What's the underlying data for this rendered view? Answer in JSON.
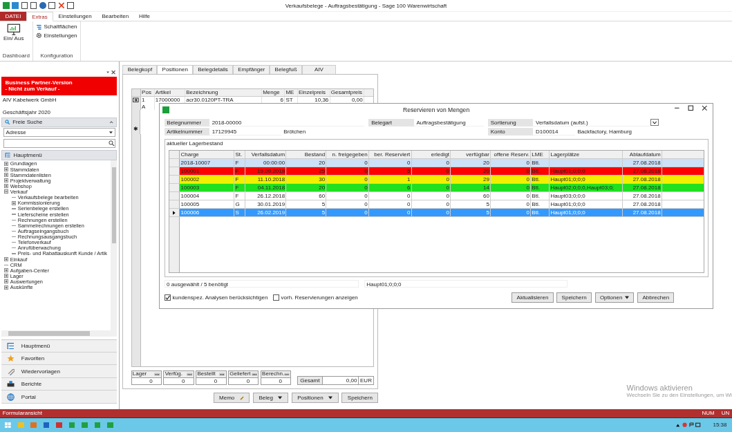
{
  "window": {
    "title": "Verkaufsbelege - Auftragsbestätigung - Sage 100 Warenwirtschaft"
  },
  "ribbon": {
    "tabs": [
      {
        "label": "DATEI",
        "kind": "file",
        "selected": false
      },
      {
        "label": "Extras",
        "kind": "tab",
        "selected": true
      },
      {
        "label": "Einstellungen",
        "kind": "tab",
        "selected": false
      },
      {
        "label": "Bearbeiten",
        "kind": "tab",
        "selected": false
      },
      {
        "label": "Hilfe",
        "kind": "tab",
        "selected": false
      }
    ],
    "groups": [
      {
        "label": "Dashboard",
        "buttons": [
          {
            "label": "Ein/ Aus",
            "kind": "large"
          }
        ]
      },
      {
        "label": "Konfiguration",
        "buttons": [
          {
            "label": "Schaltflächen",
            "kind": "list"
          },
          {
            "label": "Einstellungen",
            "kind": "gear"
          }
        ]
      }
    ]
  },
  "sidebar": {
    "banner": [
      "Business Partner-Version",
      "- Nicht zum Verkauf -"
    ],
    "company": "AIV Kabelwerk GmbH",
    "fiscal_year": "Geschäftsjahr 2020",
    "search": {
      "title": "Freie Suche",
      "category": "Adresse"
    },
    "menu_title": "Hauptmenü",
    "tree": [
      {
        "label": "Grundlagen",
        "expanded": false
      },
      {
        "label": "Stammdaten",
        "expanded": false
      },
      {
        "label": "Stammdatenlisten",
        "expanded": false
      },
      {
        "label": "Projektverwaltung",
        "expanded": false
      },
      {
        "label": "Webshop",
        "expanded": false
      },
      {
        "label": "Verkauf",
        "expanded": true,
        "children": [
          {
            "label": "Verkaufsbelege bearbeiten"
          },
          {
            "label": "Kommissionierung",
            "expanded": false
          },
          {
            "label": "Serienbelege erstellen"
          },
          {
            "label": "Lieferscheine erstellen"
          },
          {
            "label": "Rechnungen erstellen"
          },
          {
            "label": "Sammelrechnungen erstellen"
          },
          {
            "label": "Auftragseingangsbuch"
          },
          {
            "label": "Rechnungsausgangsbuch"
          },
          {
            "label": "Telefonverkauf"
          },
          {
            "label": "Anrufüberwachung"
          },
          {
            "label": "Preis- und Rabattauskunft Kunde / Artik"
          }
        ]
      },
      {
        "label": "Einkauf",
        "expanded": false
      },
      {
        "label": "CRM"
      },
      {
        "label": "Aufgaben-Center",
        "expanded": false
      },
      {
        "label": "Lager",
        "expanded": false
      },
      {
        "label": "Auswertungen",
        "expanded": false
      },
      {
        "label": "Auskünfte",
        "expanded": false
      }
    ],
    "nav": [
      {
        "label": "Hauptmenü",
        "kind": "menu"
      },
      {
        "label": "Favoriten",
        "kind": "star"
      },
      {
        "label": "Wiedervorlagen",
        "kind": "clip"
      },
      {
        "label": "Berichte",
        "kind": "printer"
      },
      {
        "label": "Portal",
        "kind": "globe"
      }
    ]
  },
  "document_tabs": [
    {
      "label": "Belegkopf",
      "selected": false
    },
    {
      "label": "Positionen",
      "selected": true
    },
    {
      "label": "Belegdetails",
      "selected": false
    },
    {
      "label": "Empfänger",
      "selected": false
    },
    {
      "label": "Belegfuß",
      "selected": false
    },
    {
      "label": "AIV",
      "selected": false
    }
  ],
  "positions": {
    "columns": [
      "Pos",
      "Artikel",
      "Bezeichnung",
      "Menge",
      "ME",
      "Einzelpreis",
      "Gesamtpreis"
    ],
    "rows": [
      [
        "1",
        "17000000",
        "acr30.0120PT-TRA",
        "6",
        "ST",
        "10,36",
        "0,00"
      ],
      [
        "A"
      ]
    ],
    "new_row_marker": "✱"
  },
  "totals": [
    {
      "label": "Lager",
      "value": "0"
    },
    {
      "label": "Verfüg.",
      "value": "0"
    },
    {
      "label": "Bestellt",
      "value": "0"
    },
    {
      "label": "Geliefert",
      "value": "0"
    },
    {
      "label": "Berechn.",
      "value": "0"
    }
  ],
  "total": {
    "label": "Gesamt",
    "value": "0,00",
    "currency": "EUR"
  },
  "bottom_buttons": [
    {
      "label": "Memo",
      "kind": "memo"
    },
    {
      "label": "Beleg",
      "kind": "menu"
    },
    {
      "label": "Positionen",
      "kind": "menu"
    },
    {
      "label": "Speichern",
      "kind": "plain"
    }
  ],
  "dialog": {
    "title": "Reservieren von Mengen",
    "fields": [
      [
        {
          "label": "Belegnummer",
          "value": "2018-00000"
        },
        {
          "label": "Belegart",
          "value": "Auftragsbestätigung"
        },
        {
          "label": "Sortierung",
          "value": "Verfallsdatum (aufst.)",
          "kind": "dropdown"
        }
      ],
      [
        {
          "label": "Artikelnummer",
          "value": "17129945",
          "extra": "Brötchen"
        },
        {
          "label": "Konto",
          "value": "D100014",
          "extra": "Backfactory, Hamburg"
        }
      ]
    ],
    "group_title": "aktueller Lagerbestand",
    "columns": [
      "Charge",
      "St.",
      "Verfallsdatum",
      "Bestand",
      "n. freigegeben",
      "ber. Reserviert",
      "erledigt",
      "verfügbar",
      "offene Reserv.",
      "LME",
      "Lagerplätze",
      "Ablaufdatum"
    ],
    "rows": [
      {
        "cells": [
          "2018-10007",
          "F",
          "00:00:00",
          "20",
          "0",
          "0",
          "0",
          "20",
          "0",
          "Btl.",
          null,
          "27.08.2018"
        ],
        "color": "#cce0f8",
        "selected": false
      },
      {
        "cells": [
          "100001",
          "F",
          "19.09.2018",
          "25",
          "0",
          "5",
          "0",
          "20",
          "0",
          "Btl.",
          "Haupt01;0;0;0",
          "27.08.2018"
        ],
        "color": "#ff0000",
        "selected": false
      },
      {
        "cells": [
          "100002",
          "F",
          "11.10.2018",
          "30",
          "0",
          "1",
          "0",
          "29",
          "0",
          "Btl.",
          "Haupt01;0;0;0",
          "27.08.2018"
        ],
        "color": "#f0f000",
        "selected": false
      },
      {
        "cells": [
          "100003",
          "F",
          "04.11.2018",
          "20",
          "0",
          "6",
          "0",
          "14",
          "0",
          "Btl.",
          "Haupt02;0;0;0,Haupt03;0;",
          "27.08.2018"
        ],
        "color": "#20e020",
        "selected": false
      },
      {
        "cells": [
          "100004",
          "F",
          "26.12.2018",
          "60",
          "0",
          "0",
          "0",
          "60",
          "0",
          "Btl.",
          "Haupt03;0;0;0",
          "27.08.2018"
        ],
        "selected": false
      },
      {
        "cells": [
          "100005",
          "G",
          "30.01.2019",
          "5",
          "0",
          "0",
          "0",
          "5",
          "0",
          "Btl.",
          "Haupt01;0;0;0",
          "27.08.2018"
        ],
        "selected": false
      },
      {
        "cells": [
          "100006",
          "S",
          "26.02.2019",
          "5",
          "0",
          "0",
          "0",
          "5",
          "0",
          "Btl.",
          "Haupt01;0;0;0",
          "27.08.2018"
        ],
        "selected": true
      }
    ],
    "summary": "0 ausgewählt / 5 benötigt",
    "location": "Haupt01;0;0;0",
    "checkboxes": [
      {
        "label": "kundenspez. Analysen berücksichtigen",
        "checked": true
      },
      {
        "label": "vorh. Reservierungen anzeigen",
        "checked": false
      }
    ],
    "buttons": [
      {
        "label": "Aktualisieren",
        "kind": "plain"
      },
      {
        "label": "Speichern",
        "kind": "plain"
      },
      {
        "label": "Optionen",
        "kind": "menu"
      },
      {
        "label": "Abbrechen",
        "kind": "plain"
      }
    ]
  },
  "activation": {
    "title": "Windows aktivieren",
    "text": "Wechseln Sie zu den Einstellungen, um Wi"
  },
  "status_bar": {
    "left": "Formularansicht",
    "indicators": [
      "NUM",
      "UN"
    ]
  },
  "taskbar": {
    "time": "15:38"
  }
}
